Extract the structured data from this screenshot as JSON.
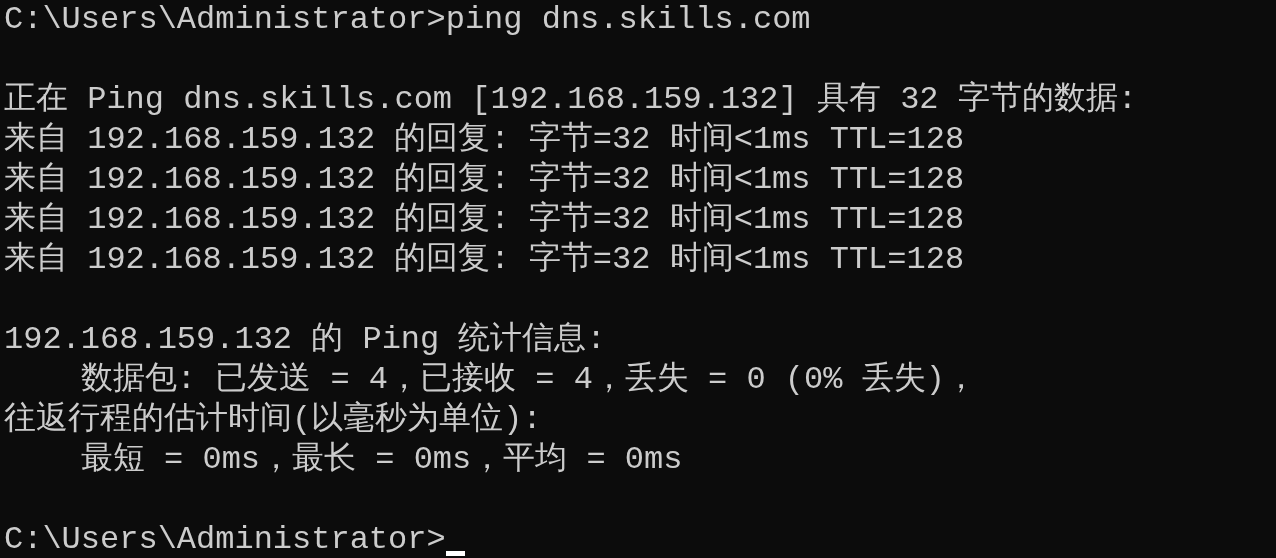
{
  "blocks": [
    {
      "lines": [
        "C:\\Users\\Administrator>ping dns.skills.com"
      ]
    },
    {
      "lines": [
        "正在 Ping dns.skills.com [192.168.159.132] 具有 32 字节的数据:",
        "来自 192.168.159.132 的回复: 字节=32 时间<1ms TTL=128",
        "来自 192.168.159.132 的回复: 字节=32 时间<1ms TTL=128",
        "来自 192.168.159.132 的回复: 字节=32 时间<1ms TTL=128",
        "来自 192.168.159.132 的回复: 字节=32 时间<1ms TTL=128"
      ]
    },
    {
      "lines": [
        "192.168.159.132 的 Ping 统计信息:",
        "    数据包: 已发送 = 4，已接收 = 4，丢失 = 0 (0% 丢失)，",
        "往返行程的估计时间(以毫秒为单位):",
        "    最短 = 0ms，最长 = 0ms，平均 = 0ms"
      ]
    }
  ],
  "prompt": {
    "text": "C:\\Users\\Administrator>",
    "cursor": true
  }
}
